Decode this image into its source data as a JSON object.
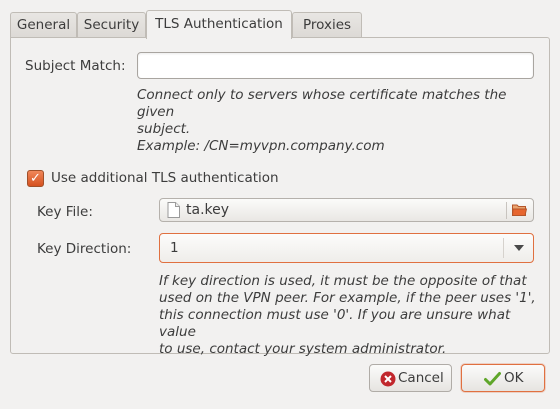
{
  "tabs": [
    {
      "label": "General"
    },
    {
      "label": "Security"
    },
    {
      "label": "TLS Authentication"
    },
    {
      "label": "Proxies"
    }
  ],
  "subject_match": {
    "label": "Subject Match:",
    "value": "",
    "hint_line1": "Connect only to servers whose certificate matches the given",
    "hint_line2": "subject.",
    "hint_line3": "Example: /CN=myvpn.company.com"
  },
  "tls_checkbox": {
    "label": "Use additional TLS authentication",
    "checked": true
  },
  "key_file": {
    "label": "Key File:",
    "value": "ta.key"
  },
  "key_direction": {
    "label": "Key Direction:",
    "value": "1",
    "hint_lines": [
      "If key direction is used, it must be the opposite of that",
      "used on the VPN peer.  For example, if the peer uses '1',",
      "this connection must use '0'.  If you are unsure what value",
      "to use, contact your system administrator."
    ]
  },
  "buttons": {
    "cancel": "Cancel",
    "ok": "OK"
  },
  "colors": {
    "accent": "#dd4814",
    "ok_check": "#5fa62a",
    "cancel_icon": "#c1272d"
  }
}
